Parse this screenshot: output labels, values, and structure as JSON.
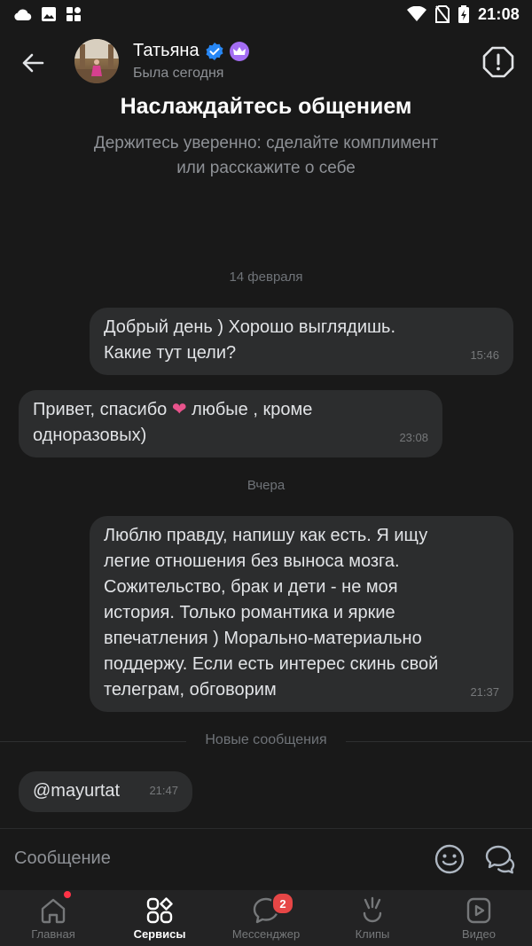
{
  "status_bar": {
    "time": "21:08",
    "left_icons": [
      "cloud-icon",
      "image-icon",
      "widgets-icon"
    ],
    "right_icons": [
      "wifi-icon",
      "no-sim-icon",
      "battery-charging-icon"
    ]
  },
  "header": {
    "name": "Татьяна",
    "last_seen": "Была сегодня",
    "badges": [
      "verified-icon",
      "crown-icon"
    ],
    "back_icon": "arrow-left-icon",
    "report_icon": "alert-octagon-icon"
  },
  "intro": {
    "title": "Наслаждайтесь общением",
    "subtitle_line1": "Держитесь уверенно: сделайте комплимент",
    "subtitle_line2": "или расскажите о себе"
  },
  "messages": [
    {
      "type": "date",
      "text": "14 февраля"
    },
    {
      "type": "out",
      "lines": [
        "Добрый день ) Хорошо выглядишь.",
        "Какие тут цели?"
      ],
      "time": "15:46"
    },
    {
      "type": "in",
      "line1_before": "Привет, спасибо ",
      "emoji": "❤",
      "line1_after": " любые , кроме",
      "line2": "одноразовых)",
      "time": "23:08"
    },
    {
      "type": "date",
      "text": "Вчера"
    },
    {
      "type": "out",
      "lines": [
        "Люблю правду, напишу как есть. Я ищу",
        "легие отношения без выноса мозга.",
        "Сожительство, брак и дети - не моя",
        "история. Только романтика и яркие",
        "впечатления ) Морально-материально",
        "поддержу. Если есть интерес скинь свой",
        "телеграм, обговорим"
      ],
      "time": "21:37"
    },
    {
      "type": "in",
      "lines": [
        "@mayurtat"
      ],
      "time": "21:47"
    }
  ],
  "new_messages_label": "Новые сообщения",
  "composer": {
    "placeholder": "Сообщение",
    "emoji_icon": "smile-icon",
    "chats_icon": "chats-icon"
  },
  "tabs": [
    {
      "label": "Главная",
      "icon": "home-icon",
      "active": false,
      "dot": true
    },
    {
      "label": "Сервисы",
      "icon": "services-icon",
      "active": true
    },
    {
      "label": "Мессенджер",
      "icon": "messenger-icon",
      "active": false,
      "badge": "2"
    },
    {
      "label": "Клипы",
      "icon": "clips-icon",
      "active": false
    },
    {
      "label": "Видео",
      "icon": "video-icon",
      "active": false
    }
  ],
  "colors": {
    "background": "#191919",
    "bubble": "#2c2d2e",
    "verified": "#2787f5",
    "crown": "#a36df3",
    "heart": "#e8538c",
    "badge": "#e64646"
  }
}
